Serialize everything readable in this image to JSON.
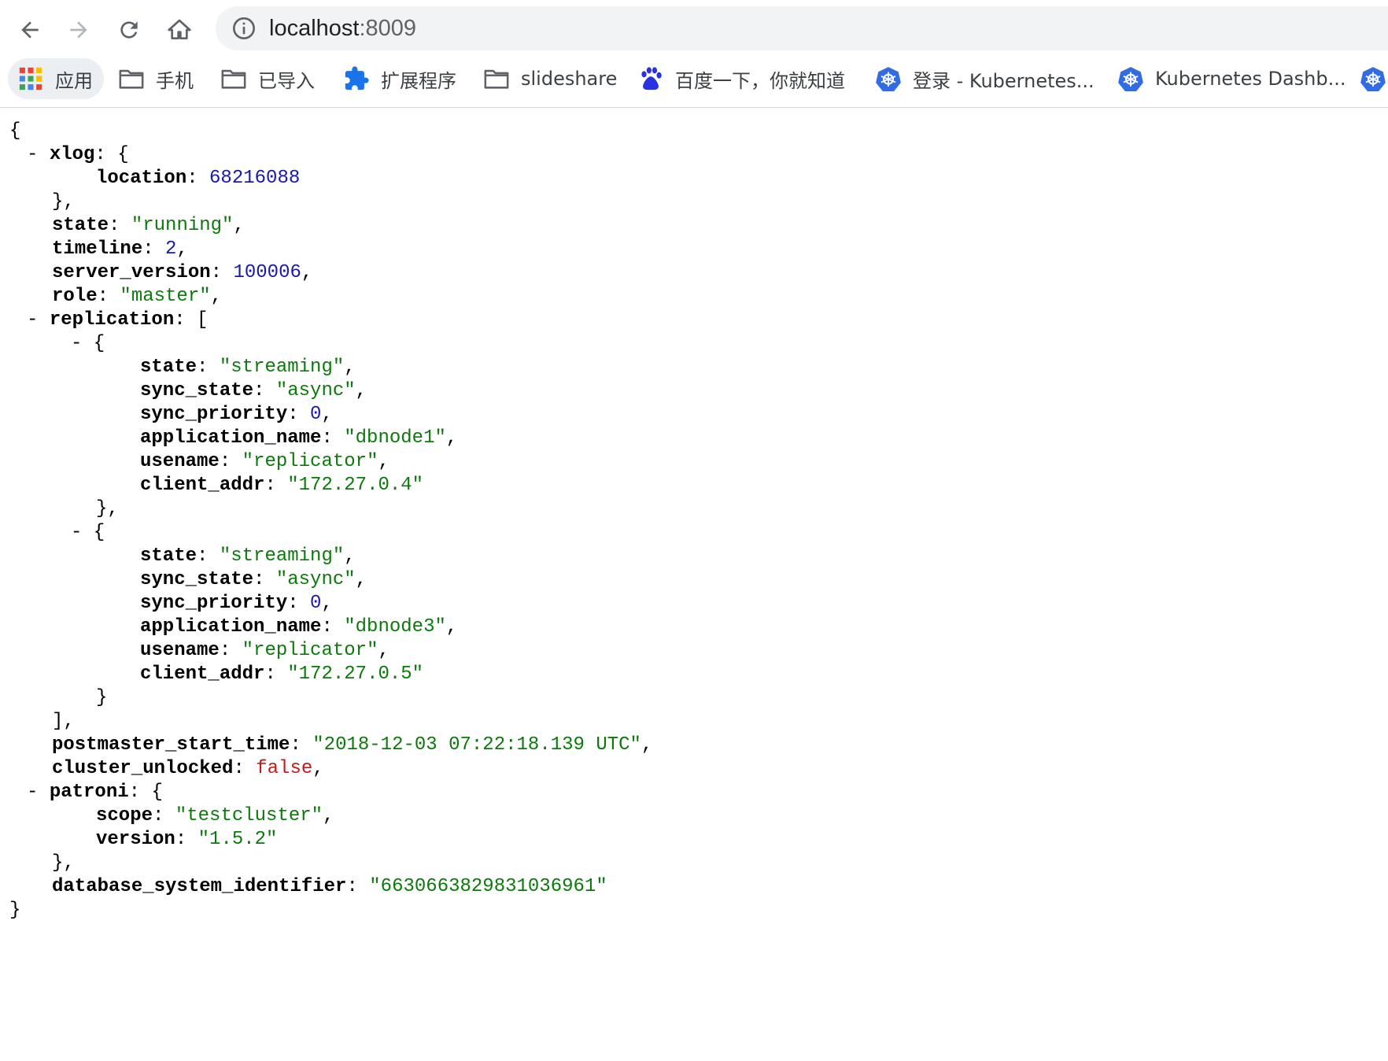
{
  "browser": {
    "url_host": "localhost",
    "url_port": ":8009",
    "bookmarks": [
      {
        "label": "应用",
        "icon": "apps-grid-icon"
      },
      {
        "label": "手机",
        "icon": "folder-icon"
      },
      {
        "label": "已导入",
        "icon": "folder-icon"
      },
      {
        "label": "扩展程序",
        "icon": "puzzle-icon"
      },
      {
        "label": "slideshare",
        "icon": "folder-icon"
      },
      {
        "label": "百度一下，你就知道",
        "icon": "baidu-paw-icon"
      },
      {
        "label": "登录 - Kubernetes...",
        "icon": "kubernetes-icon"
      },
      {
        "label": "Kubernetes Dashb...",
        "icon": "kubernetes-icon"
      }
    ]
  },
  "json": {
    "open_brace": "{",
    "close_brace": "}",
    "collapse_marker": "-",
    "xlog": {
      "key": "xlog",
      "location_key": "location",
      "location": "68216088"
    },
    "state": {
      "key": "state",
      "value": "\"running\""
    },
    "timeline": {
      "key": "timeline",
      "value": "2"
    },
    "server_version": {
      "key": "server_version",
      "value": "100006"
    },
    "role": {
      "key": "role",
      "value": "\"master\""
    },
    "replication": {
      "key": "replication",
      "items": [
        {
          "state": "\"streaming\"",
          "sync_state": "\"async\"",
          "sync_priority": "0",
          "application_name": "\"dbnode1\"",
          "usename": "\"replicator\"",
          "client_addr": "\"172.27.0.4\""
        },
        {
          "state": "\"streaming\"",
          "sync_state": "\"async\"",
          "sync_priority": "0",
          "application_name": "\"dbnode3\"",
          "usename": "\"replicator\"",
          "client_addr": "\"172.27.0.5\""
        }
      ]
    },
    "postmaster_start_time": {
      "key": "postmaster_start_time",
      "value": "\"2018-12-03 07:22:18.139 UTC\""
    },
    "cluster_unlocked": {
      "key": "cluster_unlocked",
      "value": "false"
    },
    "patroni": {
      "key": "patroni",
      "scope_key": "scope",
      "scope": "\"testcluster\"",
      "version_key": "version",
      "version": "\"1.5.2\""
    },
    "database_system_identifier": {
      "key": "database_system_identifier",
      "value": "\"6630663829831036961\""
    }
  }
}
